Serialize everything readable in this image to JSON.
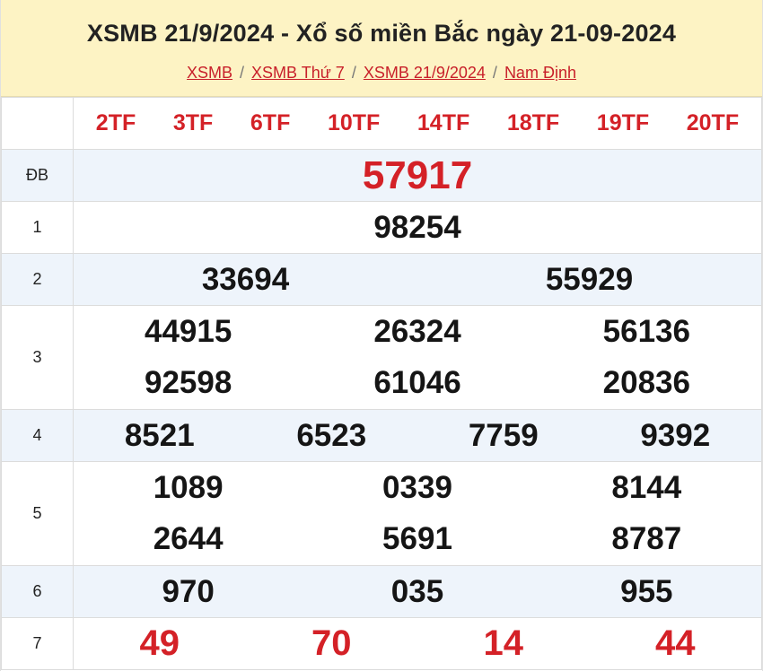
{
  "header": {
    "title": "XSMB 21/9/2024 - Xổ số miền Bắc ngày 21-09-2024",
    "breadcrumbs": [
      "XSMB",
      "XSMB Thứ 7",
      "XSMB 21/9/2024",
      "Nam Định"
    ],
    "separator": "/"
  },
  "codes": [
    "2TF",
    "3TF",
    "6TF",
    "10TF",
    "14TF",
    "18TF",
    "19TF",
    "20TF"
  ],
  "prizes": {
    "db": {
      "label": "ĐB",
      "values": [
        "57917"
      ]
    },
    "p1": {
      "label": "1",
      "values": [
        "98254"
      ]
    },
    "p2": {
      "label": "2",
      "values": [
        "33694",
        "55929"
      ]
    },
    "p3": {
      "label": "3",
      "values": [
        "44915",
        "26324",
        "56136",
        "92598",
        "61046",
        "20836"
      ]
    },
    "p4": {
      "label": "4",
      "values": [
        "8521",
        "6523",
        "7759",
        "9392"
      ]
    },
    "p5": {
      "label": "5",
      "values": [
        "1089",
        "0339",
        "8144",
        "2644",
        "5691",
        "8787"
      ]
    },
    "p6": {
      "label": "6",
      "values": [
        "970",
        "035",
        "955"
      ]
    },
    "p7": {
      "label": "7",
      "values": [
        "49",
        "70",
        "14",
        "44"
      ]
    }
  },
  "colors": {
    "accent": "#d42127",
    "header_bg": "#fdf3c4",
    "alt_row": "#eef4fb"
  }
}
